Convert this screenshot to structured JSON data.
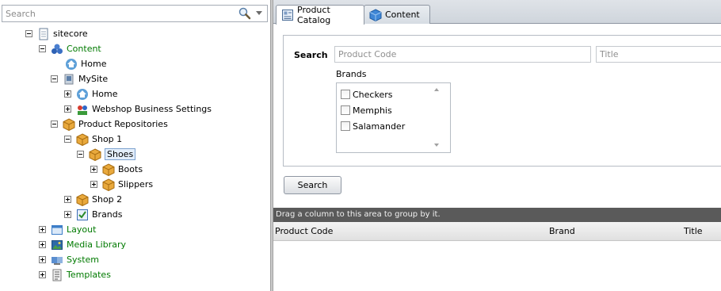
{
  "search": {
    "placeholder": "Search"
  },
  "tree": {
    "items": [
      {
        "label": "sitecore",
        "icon": "page-icon"
      },
      {
        "label": "Content",
        "icon": "content-icon"
      },
      {
        "label": "Home",
        "icon": "home-icon"
      },
      {
        "label": "MySite",
        "icon": "site-icon"
      },
      {
        "label": "Home",
        "icon": "home-icon"
      },
      {
        "label": "Webshop Business Settings",
        "icon": "settings-icon"
      },
      {
        "label": "Product Repositories",
        "icon": "box-icon"
      },
      {
        "label": "Shop 1",
        "icon": "box-icon"
      },
      {
        "label": "Shoes",
        "icon": "box-icon"
      },
      {
        "label": "Boots",
        "icon": "box-icon"
      },
      {
        "label": "Slippers",
        "icon": "box-icon"
      },
      {
        "label": "Shop 2",
        "icon": "box-icon"
      },
      {
        "label": "Brands",
        "icon": "checkbox-icon"
      },
      {
        "label": "Layout",
        "icon": "layout-icon"
      },
      {
        "label": "Media Library",
        "icon": "media-icon"
      },
      {
        "label": "System",
        "icon": "system-icon"
      },
      {
        "label": "Templates",
        "icon": "templates-icon"
      }
    ]
  },
  "tabs": [
    {
      "label": "Product Catalog",
      "active": true
    },
    {
      "label": "Content",
      "active": false
    }
  ],
  "form": {
    "search_label": "Search",
    "product_code_placeholder": "Product Code",
    "title_placeholder": "Title",
    "brands_label": "Brands",
    "brands": [
      "Checkers",
      "Memphis",
      "Salamander"
    ],
    "search_button": "Search"
  },
  "grid": {
    "group_hint": "Drag a column to this area to group by it.",
    "columns": [
      "Product Code",
      "Brand",
      "Title"
    ]
  },
  "colors": {
    "green_label": "#007a00",
    "group_bar": "#5a5a5a"
  }
}
